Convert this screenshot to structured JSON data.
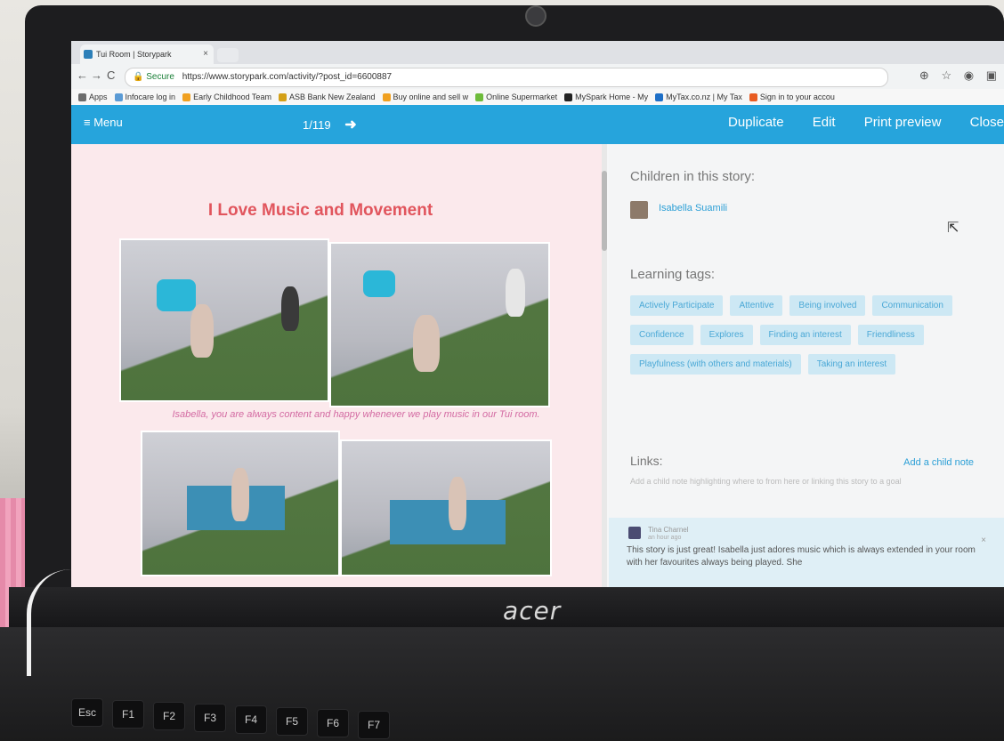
{
  "browser": {
    "tab_title": "Tui Room | Storypark",
    "tab_close": "×",
    "nav": {
      "back": "←",
      "forward": "→",
      "reload": "C"
    },
    "secure_label": "Secure",
    "url": "https://www.storypark.com/activity/?post_id=6600887",
    "window_controls": {
      "minimize": "–",
      "restore": "□"
    },
    "bookmarks": [
      {
        "label": "Apps",
        "color": "#6b6b6b"
      },
      {
        "label": "Infocare log in",
        "color": "#5b9bd5"
      },
      {
        "label": "Early Childhood Team",
        "color": "#f0a020"
      },
      {
        "label": "ASB Bank New Zealand",
        "color": "#d4a017"
      },
      {
        "label": "Buy online and sell w",
        "color": "#f0a020"
      },
      {
        "label": "Online Supermarket",
        "color": "#6dbb3a"
      },
      {
        "label": "MySpark Home - My",
        "color": "#222222"
      },
      {
        "label": "MyTax.co.nz | My Tax",
        "color": "#1e6fc7"
      },
      {
        "label": "Sign in to your accou",
        "color": "#e85b21"
      }
    ]
  },
  "header": {
    "menu_label": "≡ Menu",
    "pager": "1/119",
    "pager_arrow": "➜",
    "actions": [
      "Duplicate",
      "Edit",
      "Print preview",
      "Close"
    ],
    "bg_color": "#26a4dc"
  },
  "story": {
    "title": "I Love Music and Movement",
    "caption": "Isabella, you are always content and happy whenever we play music in our Tui room."
  },
  "sidebar": {
    "children_heading": "Children in this story:",
    "child_name": "Isabella Suamili",
    "tags_heading": "Learning tags:",
    "tags": [
      "Actively Participate",
      "Attentive",
      "Being involved",
      "Communication",
      "Confidence",
      "Explores",
      "Finding an interest",
      "Friendliness",
      "Playfulness (with others and materials)",
      "Taking an interest"
    ],
    "links_heading": "Links:",
    "add_note": "Add a child note",
    "links_hint": "Add a child note highlighting where to from here or linking this story to a goal",
    "comment": {
      "author": "Tina Charnel",
      "time": "an hour ago",
      "close": "×",
      "text": "This story is just great! Isabella just adores music which is always extended in your room with her favourites always being played. She"
    }
  },
  "laptop": {
    "brand": "acer",
    "keys": [
      "Esc",
      "F1",
      "F2",
      "F3",
      "F4",
      "F5",
      "F6",
      "F7"
    ]
  }
}
